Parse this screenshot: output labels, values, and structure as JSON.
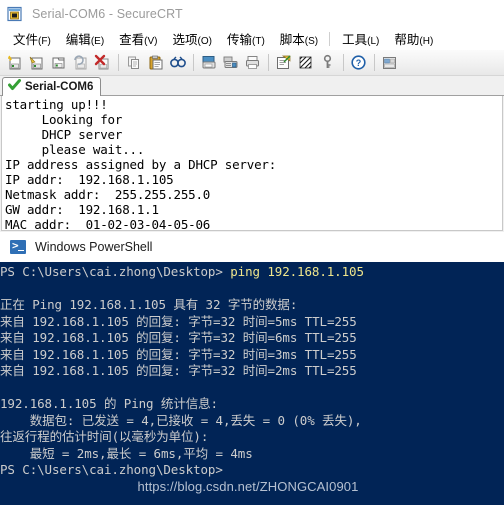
{
  "securecrt": {
    "title": "Serial-COM6 - SecureCRT",
    "app_icon": "securecrt-window-icon",
    "menu": [
      {
        "label": "文件",
        "mnemonic": "(F)",
        "name": "menu-file"
      },
      {
        "label": "编辑",
        "mnemonic": "(E)",
        "name": "menu-edit"
      },
      {
        "label": "查看",
        "mnemonic": "(V)",
        "name": "menu-view"
      },
      {
        "label": "选项",
        "mnemonic": "(O)",
        "name": "menu-options"
      },
      {
        "label": "传输",
        "mnemonic": "(T)",
        "name": "menu-transfer"
      },
      {
        "label": "脚本",
        "mnemonic": "(S)",
        "name": "menu-script"
      },
      {
        "label": "工具",
        "mnemonic": "(L)",
        "name": "menu-tools"
      },
      {
        "label": "帮助",
        "mnemonic": "(H)",
        "name": "menu-help"
      }
    ],
    "toolbar_icons": [
      "new-session-icon",
      "connect-sftp-icon",
      "clone-session-icon",
      "reconnect-icon",
      "disconnect-icon",
      "copy-icon",
      "paste-icon",
      "find-icon",
      "print-screen-icon",
      "log-session-icon",
      "print-icon",
      "session-options-icon",
      "toggle-raw-icon",
      "key-icon",
      "help-icon",
      "window-arrange-icon"
    ],
    "tab": {
      "label": "Serial-COM6",
      "status_icon": "green-check-icon"
    },
    "terminal_lines": [
      "starting up!!!",
      "     Looking for",
      "     DHCP server",
      "     please wait...",
      "IP address assigned by a DHCP server:",
      "IP addr:  192.168.1.105",
      "Netmask addr:  255.255.255.0",
      "GW addr:  192.168.1.1",
      "MAC addr:  01-02-03-04-05-06"
    ]
  },
  "powershell": {
    "title": "Windows PowerShell",
    "app_icon": "powershell-prompt-icon",
    "background_color": "#012456",
    "text_color": "#cccccc",
    "command_color": "#f0e68c",
    "prompt": "PS C:\\Users\\cai.zhong\\Desktop>",
    "command": "ping 192.168.1.105",
    "lines": [
      {
        "text": "正在 Ping 192.168.1.105 具有 32 字节的数据:",
        "kind": "output"
      },
      {
        "text": "来自 192.168.1.105 的回复: 字节=32 时间=5ms TTL=255",
        "kind": "output"
      },
      {
        "text": "来自 192.168.1.105 的回复: 字节=32 时间=6ms TTL=255",
        "kind": "output"
      },
      {
        "text": "来自 192.168.1.105 的回复: 字节=32 时间=3ms TTL=255",
        "kind": "output"
      },
      {
        "text": "来自 192.168.1.105 的回复: 字节=32 时间=2ms TTL=255",
        "kind": "output"
      },
      {
        "text": "",
        "kind": "blank"
      },
      {
        "text": "192.168.1.105 的 Ping 统计信息:",
        "kind": "output"
      },
      {
        "text": "    数据包: 已发送 = 4,已接收 = 4,丢失 = 0 (0% 丢失),",
        "kind": "output"
      },
      {
        "text": "往返行程的估计时间(以毫秒为单位):",
        "kind": "output"
      },
      {
        "text": "    最短 = 2ms,最长 = 6ms,平均 = 4ms",
        "kind": "output"
      },
      {
        "text": "PS C:\\Users\\cai.zhong\\Desktop>",
        "kind": "prompt"
      }
    ]
  },
  "watermark": "https://blog.csdn.net/ZHONGCAI0901"
}
